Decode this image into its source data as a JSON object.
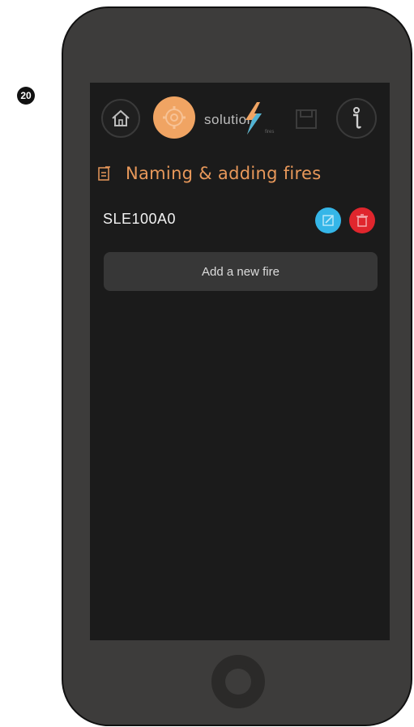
{
  "step_number": "20",
  "header": {
    "logo_text": "solution",
    "logo_sub": "fires"
  },
  "page": {
    "title": "Naming & adding fires"
  },
  "fires": [
    {
      "name": "SLE100A0"
    }
  ],
  "actions": {
    "add_fire_label": "Add a new fire"
  },
  "colors": {
    "accent_orange": "#e8985a",
    "edit_blue": "#35b6e8",
    "delete_red": "#e0262d",
    "screen_bg": "#1b1b1b",
    "phone_body": "#3d3c3b"
  },
  "icons": {
    "home": "home-icon",
    "settings": "gear-icon",
    "save": "save-icon",
    "info": "info-icon",
    "title": "edit-note-icon",
    "edit": "pencil-icon",
    "delete": "trash-icon"
  }
}
